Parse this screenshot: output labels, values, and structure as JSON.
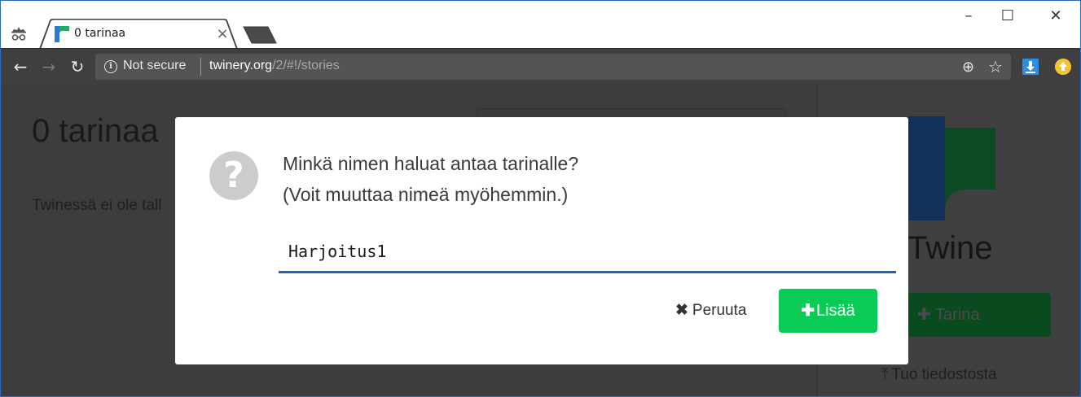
{
  "browser": {
    "tab_title": "0 tarinaa",
    "tab_close": "×",
    "security_label": "Not secure",
    "url_host": "twinery.org",
    "url_path": "/2/#!/stories",
    "window_controls": {
      "minimize": "–",
      "maximize": "☐",
      "close": "✕"
    }
  },
  "page": {
    "title": "0 tarinaa",
    "empty_message": "Twinessä ei ole tall"
  },
  "sidebar": {
    "logo_text": "Twine",
    "add_story_label": "Tarina",
    "import_label": "Tuo tiedostosta"
  },
  "dialog": {
    "prompt_line1": "Minkä nimen haluat antaa tarinalle?",
    "prompt_line2": "(Voit muuttaa nimeä myöhemmin.)",
    "input_value": "Harjoitus1",
    "cancel_label": "Peruuta",
    "add_label": "Lisää"
  },
  "colors": {
    "primary_button": "#0acb55",
    "input_underline": "#1f5fbf",
    "overlay": "#3d3d3d"
  }
}
